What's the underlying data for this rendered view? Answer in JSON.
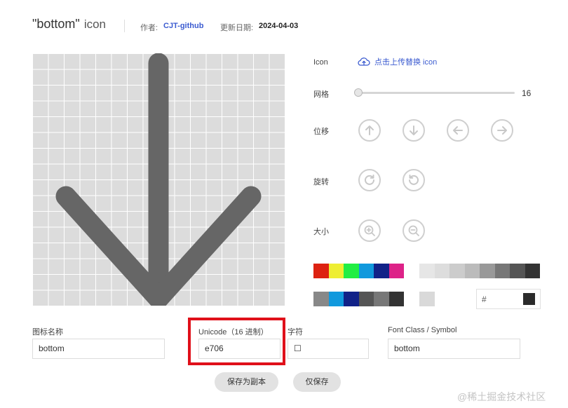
{
  "header": {
    "title": "\"bottom\"",
    "title_suffix": "icon",
    "author_label": "作者:",
    "author": "CJT-github",
    "date_label": "更新日期:",
    "date": "2024-04-03"
  },
  "controls": {
    "icon_label": "Icon",
    "upload_label": "点击上传替换 icon",
    "grid_label": "网格",
    "grid_value": "16",
    "position_label": "位移",
    "rotate_label": "旋转",
    "size_label": "大小"
  },
  "palette": {
    "colors_row1": [
      "#dd2211",
      "#eeee33",
      "#22ee44",
      "#1199dd",
      "#112288",
      "#dd2288"
    ],
    "grays_row1": [
      "#e6e6e6",
      "#dddddd",
      "#cccccc",
      "#bbbbbb",
      "#999999",
      "#777777",
      "#555555",
      "#333333"
    ],
    "colors_row2": [
      "#888888",
      "#1199dd",
      "#112288",
      "#555555",
      "#777777",
      "#333333"
    ],
    "single_swatch": "#d9d9d9",
    "hex_prefix": "#",
    "current_color": "#2b2b2b"
  },
  "fields": {
    "name_label": "图标名称",
    "name_value": "bottom",
    "unicode_label": "Unicode（16 进制）",
    "unicode_value": "e706",
    "char_label": "字符",
    "char_value": "☐",
    "fontclass_label": "Font Class / Symbol",
    "fontclass_value": "bottom"
  },
  "actions": {
    "save_copy": "保存为副本",
    "save_only": "仅保存"
  },
  "icon_color": "#666666",
  "watermark": "@稀土掘金技术社区"
}
